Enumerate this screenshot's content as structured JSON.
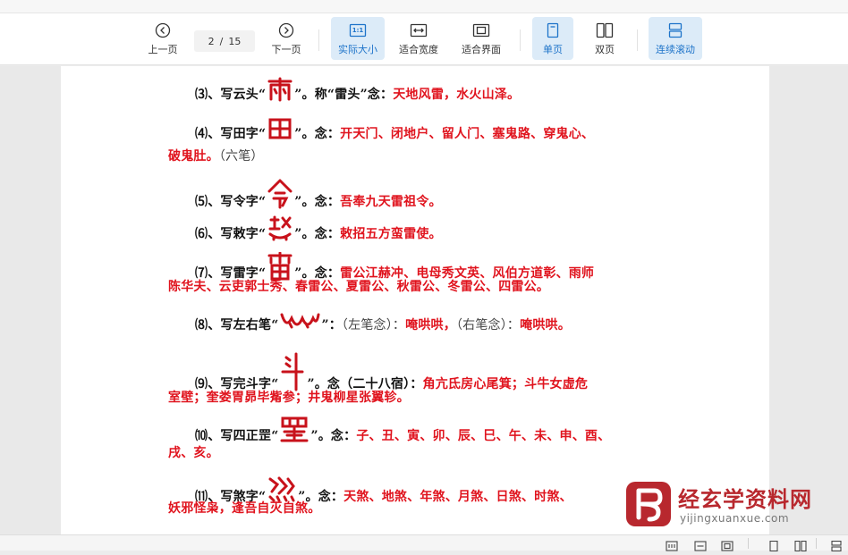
{
  "toolbar": {
    "prev_label": "上一页",
    "next_label": "下一页",
    "current_page": "2",
    "page_separator": "/",
    "total_pages": "15",
    "actual_size_label": "实际大小",
    "actual_size_icon_text": "1:1",
    "fit_width_label": "适合宽度",
    "fit_page_label": "适合界面",
    "single_page_label": "单页",
    "double_page_label": "双页",
    "continuous_label": "连续滚动"
  },
  "document": {
    "lines": [
      {
        "num": "⑶",
        "pre": "、写云头“",
        "glyph": "雨",
        "post": "”。称“雷头”念：",
        "red": "天地风雷，水火山泽。"
      },
      {
        "num": "⑷",
        "pre": "、写田字“",
        "glyph": "田",
        "post": "”。念：",
        "red": "开天门、闭地户、留人门、塞鬼路、穿鬼心、"
      },
      {
        "red2": "破鬼肚。",
        "gray": "（六笔）"
      },
      {
        "num": "⑸",
        "pre": "、写令字“",
        "glyph": "令",
        "post": "”。念：",
        "red": "吾奉九天雷祖令。"
      },
      {
        "num": "⑹",
        "pre": "、写敕字“",
        "glyph": "敕",
        "post": "”。念：",
        "red": "敕招五方蛮雷使。"
      },
      {
        "num": "⑺",
        "pre": "、写雷字“",
        "glyph": "雷",
        "post": "”。念：",
        "red": "雷公江赫冲、电母秀文英、风伯方道彰、雨师"
      },
      {
        "red2": "陈华夫、云吏郭士秀、春雷公、夏雷公、秋雷公、冬雷公、四雷公。"
      },
      {
        "num": "⑻",
        "pre": "、写左右笔“",
        "glyph": "笔",
        "post": "”：",
        "gray1": "（左笔念）：",
        "red": "唵哄哄，",
        "gray2": "（右笔念）：",
        "red3": "唵哄哄。"
      },
      {
        "num": "⑼",
        "pre": "、写完斗字“",
        "glyph": "斗",
        "post": "”。念（二十八宿）：",
        "red": "角亢氐房心尾箕；斗牛女虚危"
      },
      {
        "red2": "室壁；奎娄胃昴毕觜参；井鬼柳星张翼轸。"
      },
      {
        "num": "⑽",
        "pre": "、写四正罡“",
        "glyph": "罡",
        "post": "”。念：",
        "red": "子、丑、寅、卯、辰、巳、午、未、申、酉、"
      },
      {
        "red2": "戌、亥。"
      },
      {
        "num": "⑾",
        "pre": "、写煞字“",
        "glyph": "煞",
        "post": "”。念：",
        "red": "天煞、地煞、年煞、月煞、日煞、时煞、"
      },
      {
        "red2": "妖邪怪枭，逢吾自灭自煞。"
      }
    ]
  },
  "watermark": {
    "title": "经玄学资料网",
    "url": "yijingxuanxue.com"
  },
  "colors": {
    "accent": "#1d73c9",
    "active_bg": "#dcebf8",
    "red_text": "#e0141e",
    "watermark_red": "#b8282e"
  }
}
